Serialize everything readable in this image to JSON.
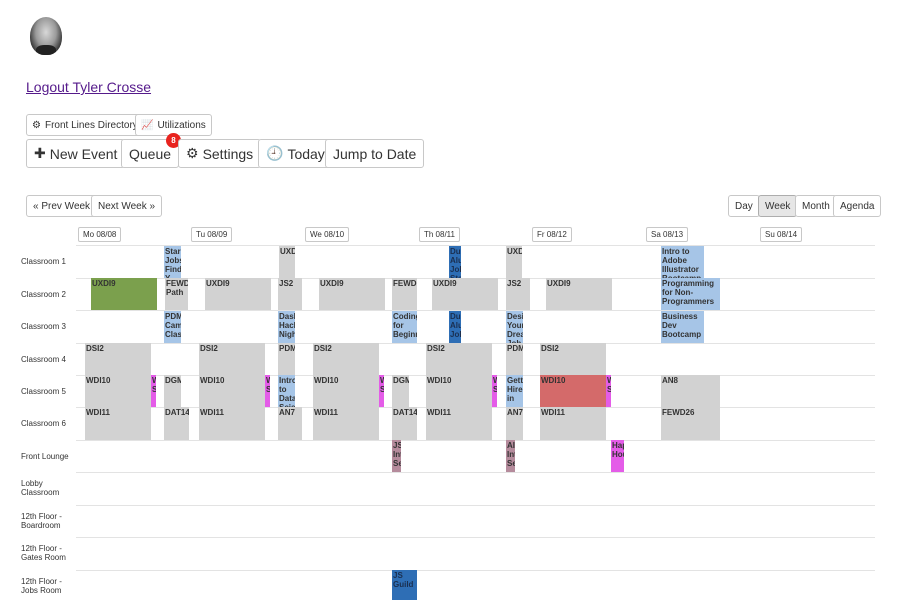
{
  "user": {
    "logout_text": "Logout Tyler Crosse"
  },
  "toolbar_small": {
    "directory": "Front Lines Directory",
    "utilizations": "Utilizations"
  },
  "toolbar": {
    "new_event": "New Event",
    "queue": "Queue",
    "queue_badge": "8",
    "settings": "Settings",
    "today": "Today",
    "jump_to_date": "Jump to Date"
  },
  "nav": {
    "prev_week": "« Prev Week",
    "next_week": "Next Week »"
  },
  "views": {
    "day": "Day",
    "week": "Week",
    "month": "Month",
    "agenda": "Agenda",
    "selected": "Week"
  },
  "days": [
    "Mo 08/08",
    "Tu 08/09",
    "We 08/10",
    "Th 08/11",
    "Fr 08/12",
    "Sa 08/13",
    "Su 08/14"
  ],
  "rooms": [
    "Classroom 1",
    "Classroom 2",
    "Classroom 3",
    "Classroom 4",
    "Classroom 5",
    "Classroom 6",
    "Front Lounge",
    "Lobby Classroom",
    "12th Floor - Boardroom",
    "12th Floor - Gates Room",
    "12th Floor - Jobs Room"
  ],
  "colors": {
    "gray": "#d2d2d2",
    "light_blue": "#a6c5e7",
    "dark_blue": "#2e6eb5",
    "green": "#7ba04d",
    "red": "#d46a6a",
    "magenta": "#e45ce8",
    "mauve": "#b58b9c",
    "badge": "#e8231e"
  },
  "events": {
    "c1_start": "Star Jobs Find Y...",
    "c1_uxd": "UXD",
    "c1_dubl": "Du Alu Job Sta up",
    "c1_uxd2": "UXD",
    "c1_illustrator": "Intro to Adobe Illustrator Bootcamp",
    "c2_uxdi9_mo": "UXDI9",
    "c2_fewd_path": "FEWD Path",
    "c2_uxdi9_tu": "UXDI9",
    "c2_js2_tu": "JS2",
    "c2_uxdi9_we": "UXDI9",
    "c2_fewd_we": "FEWD",
    "c2_uxdi9_th": "UXDI9",
    "c2_js2_th": "JS2",
    "c2_uxdi9_fr": "UXDI9",
    "c2_prog": "Programming for Non-Programmers",
    "c3_pdm": "PDM Camp Class",
    "c3_dash": "Dash Hack Night",
    "c3_coding": "Coding for Beginners",
    "c3_dual": "Du Alu Job",
    "c3_design": "Desi Your Dream Job",
    "c3_business": "Business Dev Bootcamp",
    "c4_dsi2_mo": "DSI2",
    "c4_dsi2_tu": "DSI2",
    "c4_pdm_tu": "PDM",
    "c4_dsi2_we": "DSI2",
    "c4_dsi2_th": "DSI2",
    "c4_pdm_th": "PDM",
    "c4_dsi2_fr": "DSI2",
    "c5_wdi10_mo": "WDI10",
    "c5_dgm_mo": "DGM",
    "c5_wdi10_tu": "WDI10",
    "c5_intro": "Intro to Data Scie",
    "c5_wdi10_we": "WDI10",
    "c5_dgm_we": "DGM",
    "c5_wdi10_th": "WDI10",
    "c5_getting": "Getti Hired in",
    "c5_wdi10_fr": "WDI10",
    "c5_an8": "AN8",
    "c5_mag_mo": "W S",
    "c5_mag_tu": "W S",
    "c5_mag_we": "W S",
    "c5_mag_th": "W S",
    "c5_mag_fr": "W S",
    "c6_wdi11_mo": "WDI11",
    "c6_dat14": "DAT14",
    "c6_wdi11_tu": "WDI11",
    "c6_an7_tu": "AN7",
    "c6_wdi11_we": "WDI11",
    "c6_dat14_we": "DAT14",
    "c6_wdi11_th": "WDI11",
    "c6_an7_th": "AN7",
    "c6_wdi11_fr": "WDI11",
    "c6_fewd26": "FEWD26",
    "fl_js_int": "JS Int Se",
    "fl_ai_int": "AI Int Se",
    "fl_happy": "Hap Hou",
    "jr_js_guild": "JS Guild"
  }
}
